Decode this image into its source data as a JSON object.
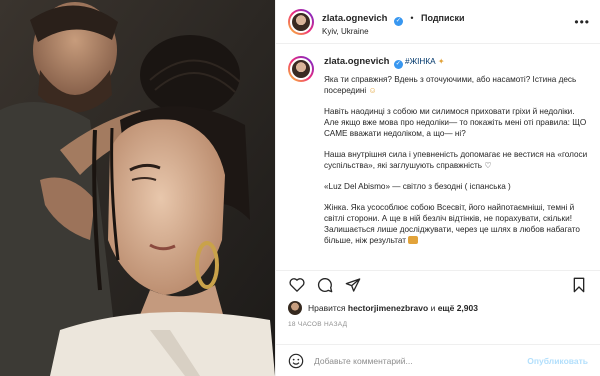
{
  "header": {
    "username": "zlata.ognevich",
    "follow_label": "Подписки",
    "location": "Kyiv, Ukraine",
    "more_icon": "ellipsis-icon"
  },
  "caption": {
    "username": "zlata.ognevich",
    "hashtag": "#ЖІНКА",
    "paragraphs": [
      "Яка ти справжня? Вдень з оточуючими, або насамоті? Істина десь посередині",
      "Навіть наодинці з собою ми силимося приховати гріхи й недоліки. Але якщо вже мова про недоліки— то покажіть мені оті правила: ЩО САМЕ вважати недоліком, а що— ні?",
      "Наша внутрішня сила і упевненість допомагає не вестися на «голоси суспільства», які заглушують справжність",
      "«Luz Del Abismo» — світло з безодні ( іспанська )",
      "Жінка. Яка усособлює собою Всесвіт, його найпотаємніші, темні й світлі сторони. А ще в ній безліч відтінків, не порахувати, скільки! Залишається лише досліджувати, через це шлях в любов набагато більше, ніж результат"
    ]
  },
  "actions": {
    "like_icon": "heart-icon",
    "comment_icon": "comment-icon",
    "share_icon": "share-icon",
    "save_icon": "bookmark-icon"
  },
  "likes": {
    "prefix": "Нравится",
    "user": "hectorjimenezbravo",
    "middle": "и",
    "count": "ещё 2,903"
  },
  "time_ago": "18 ЧАСОВ НАЗАД",
  "comment": {
    "placeholder": "Добавьте комментарий...",
    "publish_label": "Опубликовать",
    "emoji_icon": "emoji-icon"
  },
  "colors": {
    "accent": "#3897f0",
    "link": "#00376b",
    "muted": "#8e8e8e",
    "publish_disabled": "#b2dffc"
  }
}
